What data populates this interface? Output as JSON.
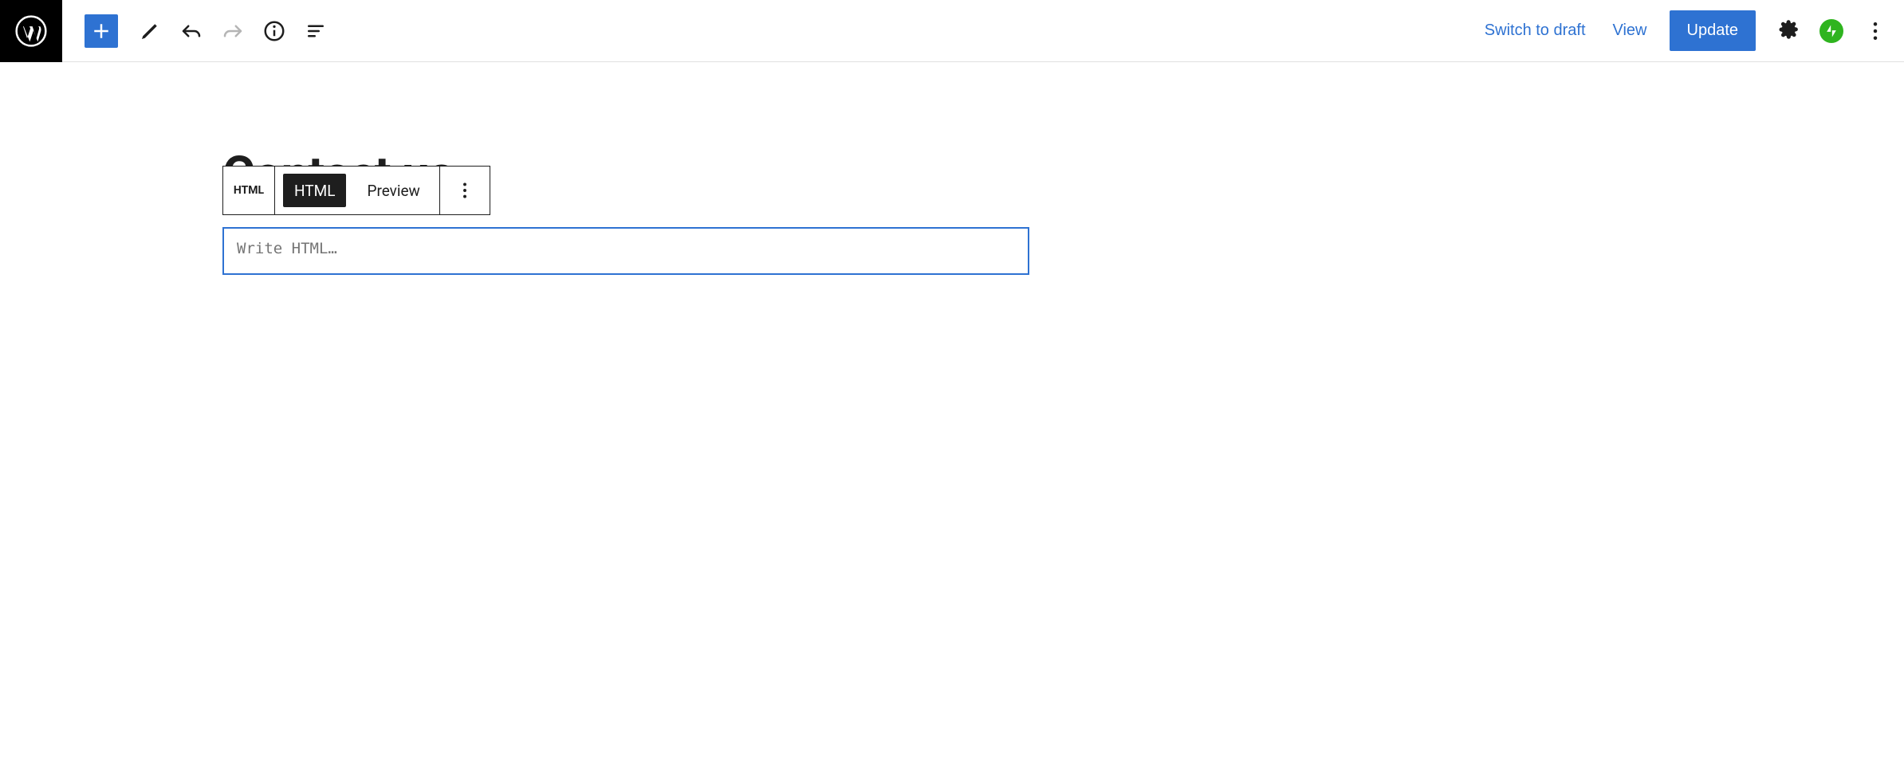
{
  "header": {
    "switch_draft": "Switch to draft",
    "view": "View",
    "update": "Update"
  },
  "page_title": "Contact us",
  "block_toolbar": {
    "type_label": "HTML",
    "html_tab": "HTML",
    "preview_tab": "Preview"
  },
  "editor": {
    "placeholder": "Write HTML…"
  }
}
